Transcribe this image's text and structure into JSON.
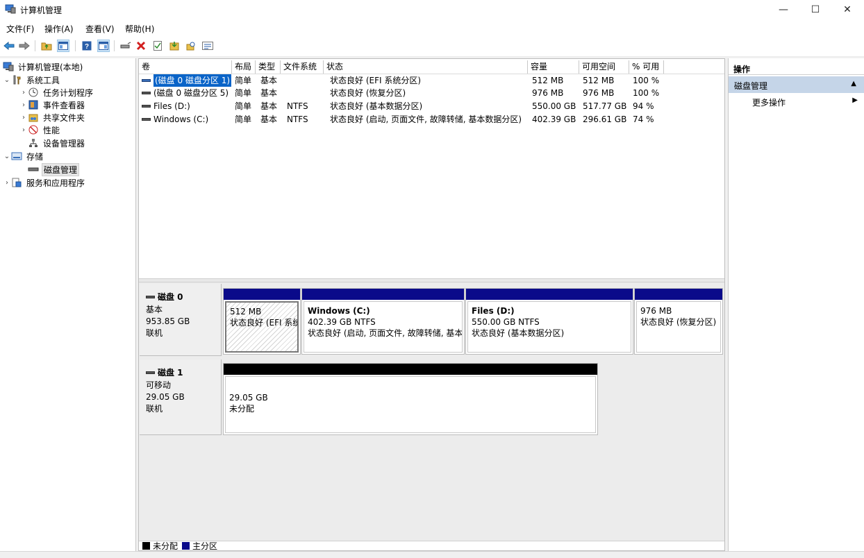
{
  "window": {
    "title": "计算机管理",
    "minimize": "—",
    "maximize": "☐",
    "close": "✕"
  },
  "menu": [
    "文件(F)",
    "操作(A)",
    "查看(V)",
    "帮助(H)"
  ],
  "tree": {
    "root": "计算机管理(本地)",
    "system_tools": "系统工具",
    "task_scheduler": "任务计划程序",
    "event_viewer": "事件查看器",
    "shared_folders": "共享文件夹",
    "performance": "性能",
    "device_manager": "设备管理器",
    "storage": "存储",
    "disk_management": "磁盘管理",
    "services_apps": "服务和应用程序"
  },
  "columns": [
    "卷",
    "布局",
    "类型",
    "文件系统",
    "状态",
    "容量",
    "可用空间",
    "% 可用"
  ],
  "volumes": [
    {
      "name": "(磁盘 0 磁盘分区 1)",
      "layout": "简单",
      "type": "基本",
      "fs": "",
      "status": "状态良好 (EFI 系统分区)",
      "capacity": "512 MB",
      "free": "512 MB",
      "pct": "100 %"
    },
    {
      "name": "(磁盘 0 磁盘分区 5)",
      "layout": "简单",
      "type": "基本",
      "fs": "",
      "status": "状态良好 (恢复分区)",
      "capacity": "976 MB",
      "free": "976 MB",
      "pct": "100 %"
    },
    {
      "name": "Files (D:)",
      "layout": "简单",
      "type": "基本",
      "fs": "NTFS",
      "status": "状态良好 (基本数据分区)",
      "capacity": "550.00 GB",
      "free": "517.77 GB",
      "pct": "94 %"
    },
    {
      "name": "Windows (C:)",
      "layout": "简单",
      "type": "基本",
      "fs": "NTFS",
      "status": "状态良好 (启动, 页面文件, 故障转储, 基本数据分区)",
      "capacity": "402.39 GB",
      "free": "296.61 GB",
      "pct": "74 %"
    }
  ],
  "disks": [
    {
      "name": "磁盘 0",
      "kind": "基本",
      "size": "953.85 GB",
      "state": "联机",
      "partitions": [
        {
          "title": "",
          "line1": "512 MB",
          "line2": "状态良好 (EFI 系统",
          "bar_color": "#0a0a8a"
        },
        {
          "title": "Windows  (C:)",
          "line1": "402.39 GB NTFS",
          "line2": "状态良好 (启动, 页面文件, 故障转储, 基本",
          "bar_color": "#0a0a8a"
        },
        {
          "title": "Files  (D:)",
          "line1": "550.00 GB NTFS",
          "line2": "状态良好 (基本数据分区)",
          "bar_color": "#0a0a8a"
        },
        {
          "title": "",
          "line1": "976 MB",
          "line2": "状态良好 (恢复分区)",
          "bar_color": "#0a0a8a"
        }
      ]
    },
    {
      "name": "磁盘 1",
      "kind": "可移动",
      "size": "29.05 GB",
      "state": "联机",
      "partitions": [
        {
          "title": "",
          "line1": "29.05 GB",
          "line2": "未分配",
          "bar_color": "#000000"
        }
      ]
    }
  ],
  "legend": [
    {
      "label": "未分配",
      "color": "#000000"
    },
    {
      "label": "主分区",
      "color": "#0a0a8a"
    }
  ],
  "actions": {
    "header": "操作",
    "section": "磁盘管理",
    "more": "更多操作"
  },
  "colors": {
    "selection": "#0a64c8",
    "primary_partition": "#0a0a8a",
    "unallocated": "#000000",
    "action_section_bg": "#c5d5e8"
  }
}
